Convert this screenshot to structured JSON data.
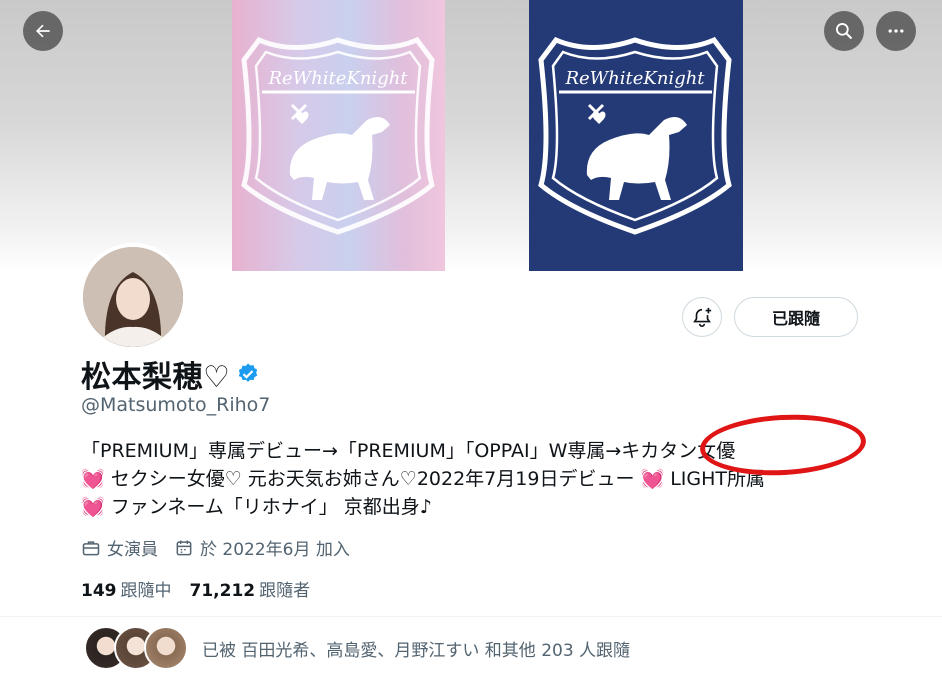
{
  "header": {
    "back_icon": "arrow-left-icon",
    "search_icon": "search-icon",
    "more_icon": "more-horizontal-icon"
  },
  "banner": {
    "logo_text": "ReWhiteKnight",
    "left_colors": [
      "#e7b2cf",
      "#c9d0ee"
    ],
    "right_color": "#243a77"
  },
  "profile": {
    "display_name": "松本梨穂♡",
    "verified_color": "#1d9bf0",
    "handle": "@Matsumoto_Riho7",
    "bell_icon": "notification-bell-plus-icon",
    "follow_label": "已跟隨",
    "bio": {
      "line1": "「PREMIUM」専属デビュー→「PREMIUM」「OPPAI」W専属→キカタン女優",
      "line2_text": "セクシー女優♡ 元お天気お姉さん♡2022年7月19日デビュー",
      "line2_tail": "LIGHT所属",
      "line3_text": "ファンネーム「リホナイ」 京都出身♪",
      "heart_emoji": "💓"
    },
    "category": "女演員",
    "joined": "於 2022年6月 加入",
    "following_count": "149",
    "following_label": "跟隨中",
    "followers_count": "71,212",
    "followers_label": "跟隨者",
    "followed_by": "已被 百田光希、高島愛、月野江すい 和其他 203 人跟隨"
  },
  "annotation": {
    "color": "#e01515"
  }
}
